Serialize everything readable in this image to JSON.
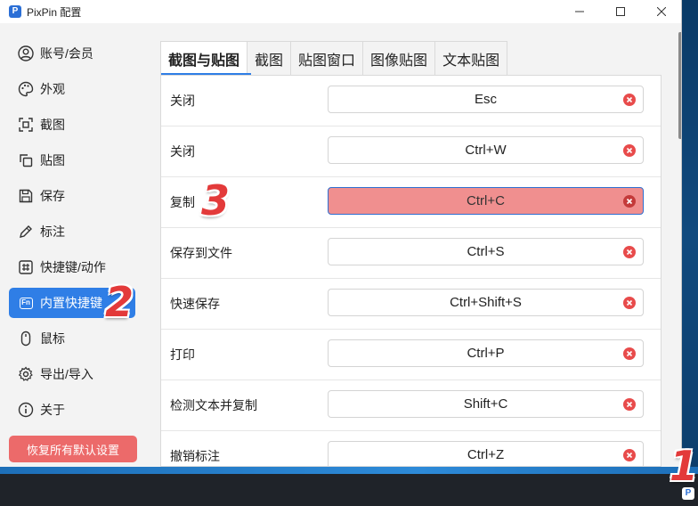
{
  "window": {
    "title": "PixPin 配置",
    "app_icon": "P"
  },
  "sidebar": {
    "items": [
      {
        "label": "账号/会员",
        "icon": "user-circle-icon"
      },
      {
        "label": "外观",
        "icon": "palette-icon"
      },
      {
        "label": "截图",
        "icon": "screenshot-frame-icon"
      },
      {
        "label": "贴图",
        "icon": "pin-copy-icon"
      },
      {
        "label": "保存",
        "icon": "save-icon"
      },
      {
        "label": "标注",
        "icon": "pencil-icon"
      },
      {
        "label": "快捷键/动作",
        "icon": "hash-icon"
      },
      {
        "label": "内置快捷键",
        "icon": "fn-key-icon",
        "badge": "Fn",
        "active": true
      },
      {
        "label": "鼠标",
        "icon": "mouse-icon"
      },
      {
        "label": "导出/导入",
        "icon": "gear-icon"
      },
      {
        "label": "关于",
        "icon": "info-icon"
      }
    ],
    "reset_label": "恢复所有默认设置"
  },
  "tabs": [
    {
      "label": "截图与贴图",
      "active": true
    },
    {
      "label": "截图"
    },
    {
      "label": "贴图窗口"
    },
    {
      "label": "图像贴图"
    },
    {
      "label": "文本贴图"
    }
  ],
  "shortcuts": [
    {
      "label": "关闭",
      "key": "Esc"
    },
    {
      "label": "关闭",
      "key": "Ctrl+W"
    },
    {
      "label": "复制",
      "key": "Ctrl+C",
      "selected": true
    },
    {
      "label": "保存到文件",
      "key": "Ctrl+S"
    },
    {
      "label": "快速保存",
      "key": "Ctrl+Shift+S"
    },
    {
      "label": "打印",
      "key": "Ctrl+P"
    },
    {
      "label": "检测文本并复制",
      "key": "Shift+C"
    },
    {
      "label": "撤销标注",
      "key": "Ctrl+Z"
    }
  ],
  "annotations": {
    "step1": "1",
    "step2": "2",
    "step3": "3"
  },
  "taskbar": {
    "tray_icon": "P"
  },
  "colors": {
    "accent": "#2f7ee6",
    "selected_field": "#f08f8f",
    "reset_button": "#ec6a6a",
    "clear_icon": "#e84b4b",
    "step_number": "#e33a3a"
  }
}
